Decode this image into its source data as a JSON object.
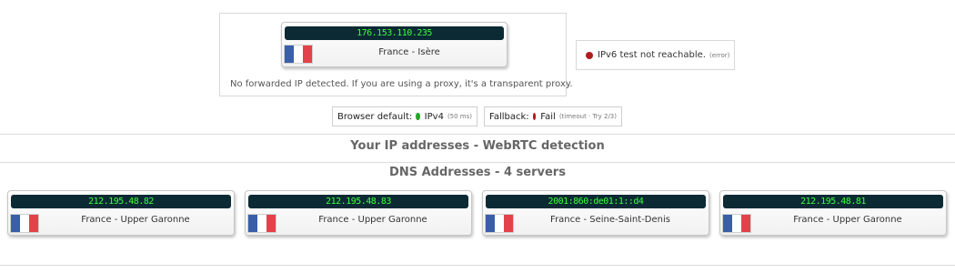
{
  "main_ip": {
    "address": "176.153.110.235",
    "location": "France - Isère",
    "country_flag": "france-flag"
  },
  "proxy_note": "No forwarded IP detected. If you are using a proxy, it's a transparent proxy.",
  "ipv6": {
    "status_color": "#b01c1c",
    "text": "IPv6 test not reachable.",
    "detail": "(error)"
  },
  "browser_default": {
    "label": "Browser default:",
    "status_color": "#2aa52a",
    "protocol": "IPv4",
    "timing": "(50 ms)"
  },
  "fallback": {
    "label": "Fallback:",
    "status_color": "#b01c1c",
    "value": "Fail",
    "detail": "(timeout · Try 2/3)"
  },
  "webrtc_heading": "Your IP addresses - WebRTC detection",
  "dns_heading": "DNS Addresses - 4 servers",
  "dns_servers": [
    {
      "address": "212.195.48.82",
      "location": "France - Upper Garonne"
    },
    {
      "address": "212.195.48.83",
      "location": "France - Upper Garonne"
    },
    {
      "address": "2001:860:de01:1::d4",
      "location": "France - Seine-Saint-Denis"
    },
    {
      "address": "212.195.48.81",
      "location": "France - Upper Garonne"
    }
  ],
  "colors": {
    "ip_bar_bg": "#0b2a33",
    "ip_text": "#3dff3d",
    "flag_blue": "#3a5fa8",
    "flag_white": "#ffffff",
    "flag_red": "#e3424b"
  }
}
